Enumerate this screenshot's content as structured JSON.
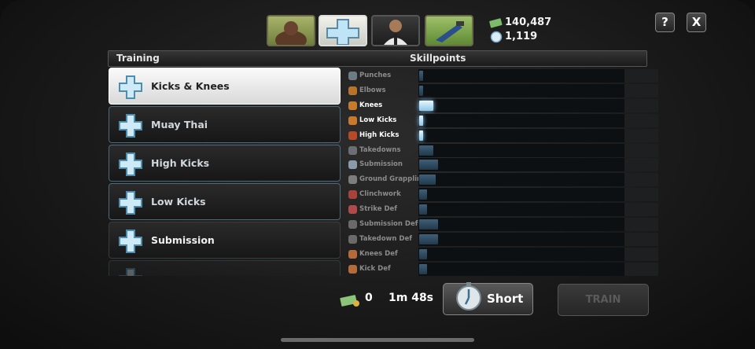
{
  "tabs": [
    {
      "name": "fighter-tab",
      "icon": "fighter-portrait-icon"
    },
    {
      "name": "training-tab",
      "icon": "plus-icon",
      "selected": true
    },
    {
      "name": "coach-tab",
      "icon": "coach-portrait-icon"
    },
    {
      "name": "gym-tab",
      "icon": "treadmill-icon"
    }
  ],
  "currency": {
    "cash": "140,487",
    "coins": "1,119"
  },
  "buttons": {
    "help": "?",
    "close": "X",
    "short": "Short",
    "train": "TRAIN"
  },
  "header": {
    "training": "Training",
    "skillpoints": "Skillpoints"
  },
  "training_list": [
    {
      "label": "Kicks & Knees",
      "selected": true
    },
    {
      "label": "Muay Thai"
    },
    {
      "label": "High Kicks"
    },
    {
      "label": "Low Kicks"
    },
    {
      "label": "Submission"
    },
    {
      "label": ""
    }
  ],
  "skills": [
    {
      "name": "Punches",
      "level": 0.02,
      "active": false,
      "color": "#6d7b84"
    },
    {
      "name": "Elbows",
      "level": 0.02,
      "active": false,
      "color": "#b8742a"
    },
    {
      "name": "Knees",
      "level": 0.07,
      "active": true,
      "color": "#c77a2c"
    },
    {
      "name": "Low Kicks",
      "level": 0.02,
      "active": true,
      "color": "#c77a2c"
    },
    {
      "name": "High Kicks",
      "level": 0.02,
      "active": true,
      "color": "#b84a2a"
    },
    {
      "name": "Takedowns",
      "level": 0.07,
      "active": false,
      "color": "#6b6f74"
    },
    {
      "name": "Submission",
      "level": 0.09,
      "active": false,
      "color": "#8b9aa8"
    },
    {
      "name": "Ground Grappling",
      "level": 0.08,
      "active": false,
      "color": "#7d7d7d"
    },
    {
      "name": "Clinchwork",
      "level": 0.04,
      "active": false,
      "color": "#a8433c"
    },
    {
      "name": "Strike Def",
      "level": 0.04,
      "active": false,
      "color": "#b04a4a"
    },
    {
      "name": "Submission Def",
      "level": 0.09,
      "active": false,
      "color": "#6a6a6a"
    },
    {
      "name": "Takedown Def",
      "level": 0.09,
      "active": false,
      "color": "#6a6a6a"
    },
    {
      "name": "Knees Def",
      "level": 0.04,
      "active": false,
      "color": "#b46a3a"
    },
    {
      "name": "Kick Def",
      "level": 0.04,
      "active": false,
      "color": "#b46a3a"
    }
  ],
  "footer": {
    "cost": "0",
    "time": "1m 48s"
  }
}
